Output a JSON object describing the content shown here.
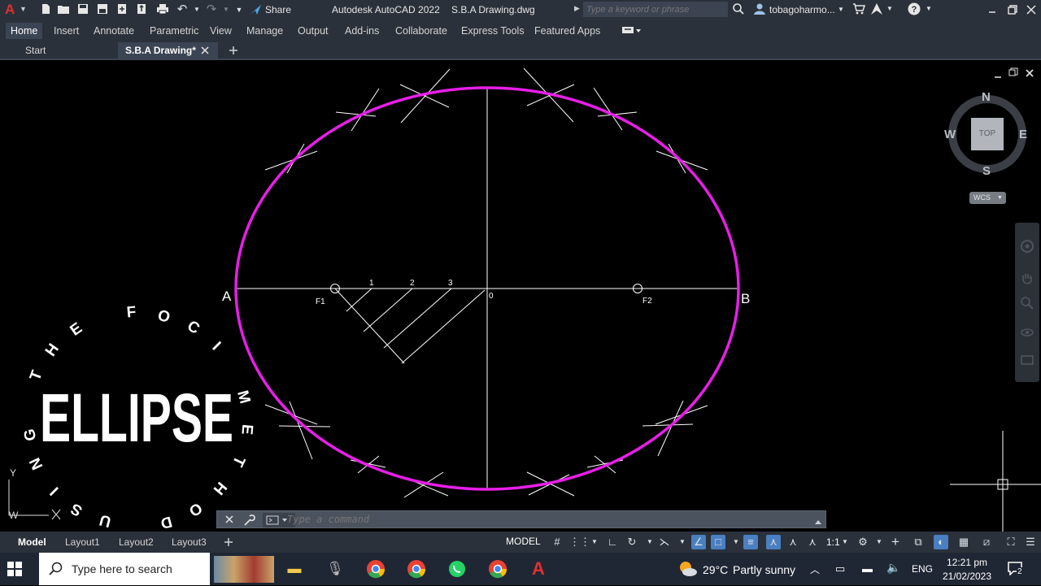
{
  "titlebar": {
    "app_letter": "A",
    "share_label": "Share",
    "app_title": "Autodesk AutoCAD 2022",
    "file_name": "S.B.A Drawing.dwg",
    "search_placeholder": "Type a keyword or phrase",
    "user_name": "tobagoharmo..."
  },
  "ribbon": {
    "tabs": [
      "Home",
      "Insert",
      "Annotate",
      "Parametric",
      "View",
      "Manage",
      "Output",
      "Add-ins",
      "Collaborate",
      "Express Tools",
      "Featured Apps"
    ]
  },
  "file_tabs": {
    "start": "Start",
    "active": "S.B.A Drawing*"
  },
  "drawing": {
    "point_a": "A",
    "point_b": "B",
    "focus_1": "F1",
    "focus_2": "F2",
    "origin": "0",
    "div_1": "1",
    "div_2": "2",
    "div_3": "3",
    "ellipse_color": "#e81ee8"
  },
  "overlay": {
    "big_word": "ELLIPSE",
    "arc_letters": [
      "G",
      "T",
      "H",
      "E",
      "F",
      "O",
      "C",
      "I",
      "M",
      "E",
      "T",
      "H",
      "O",
      "D",
      "U",
      "S",
      "I",
      "N"
    ]
  },
  "viewcube": {
    "north": "N",
    "south": "S",
    "east": "E",
    "west": "W",
    "face": "TOP",
    "wcs": "WCS"
  },
  "ucs": {
    "y": "Y",
    "w": "W"
  },
  "command": {
    "placeholder": "Type a command"
  },
  "layout_tabs": {
    "tabs": [
      "Model",
      "Layout1",
      "Layout2",
      "Layout3"
    ],
    "model_button": "MODEL",
    "scale": "1:1"
  },
  "taskbar": {
    "search_placeholder": "Type here to search",
    "temperature": "29°C",
    "weather": "Partly sunny",
    "language": "ENG",
    "time": "12:21 pm",
    "date": "21/02/2023",
    "notification_count": "2"
  }
}
